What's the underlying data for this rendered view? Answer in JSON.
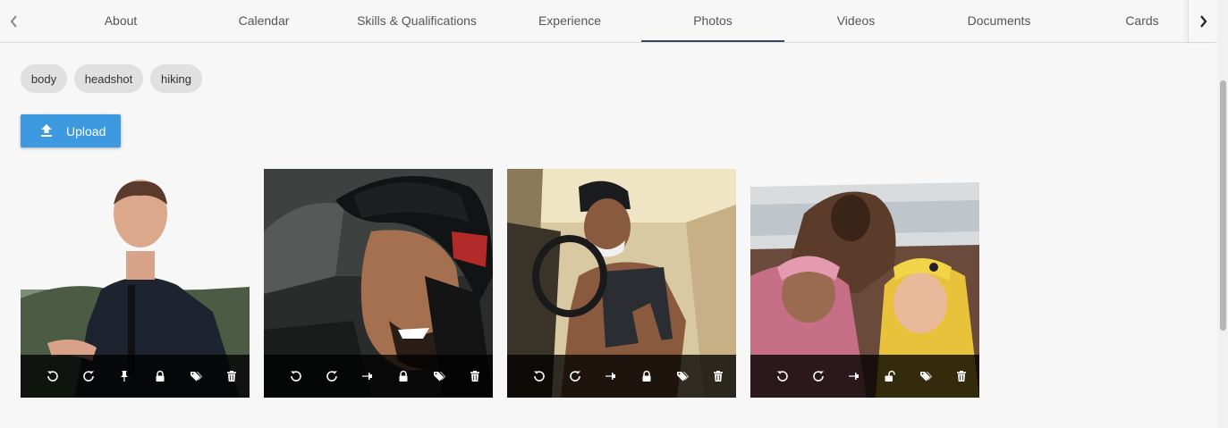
{
  "tabs": {
    "items": [
      {
        "label": "About"
      },
      {
        "label": "Calendar"
      },
      {
        "label": "Skills & Qualifications"
      },
      {
        "label": "Experience"
      },
      {
        "label": "Photos",
        "active": true
      },
      {
        "label": "Videos"
      },
      {
        "label": "Documents"
      },
      {
        "label": "Cards"
      }
    ]
  },
  "tags": {
    "items": [
      {
        "label": "body"
      },
      {
        "label": "headshot"
      },
      {
        "label": "hiking"
      }
    ]
  },
  "upload": {
    "label": "Upload",
    "icon": "upload-icon"
  },
  "photos": [
    {
      "alt": "",
      "pinned": true,
      "locked": true
    },
    {
      "alt": "",
      "pinned": false,
      "locked": true
    },
    {
      "alt": "",
      "pinned": false,
      "locked": true
    },
    {
      "alt": "",
      "pinned": false,
      "locked": false
    }
  ],
  "photo_actions": [
    "rotate-left-icon",
    "rotate-right-icon",
    "pin-icon",
    "lock-icon",
    "tags-icon",
    "trash-icon"
  ],
  "colors": {
    "accent": "#3d9ae0",
    "active_tab_indicator": "#3b4863",
    "toolbar_bg": "#1c1c1c"
  }
}
